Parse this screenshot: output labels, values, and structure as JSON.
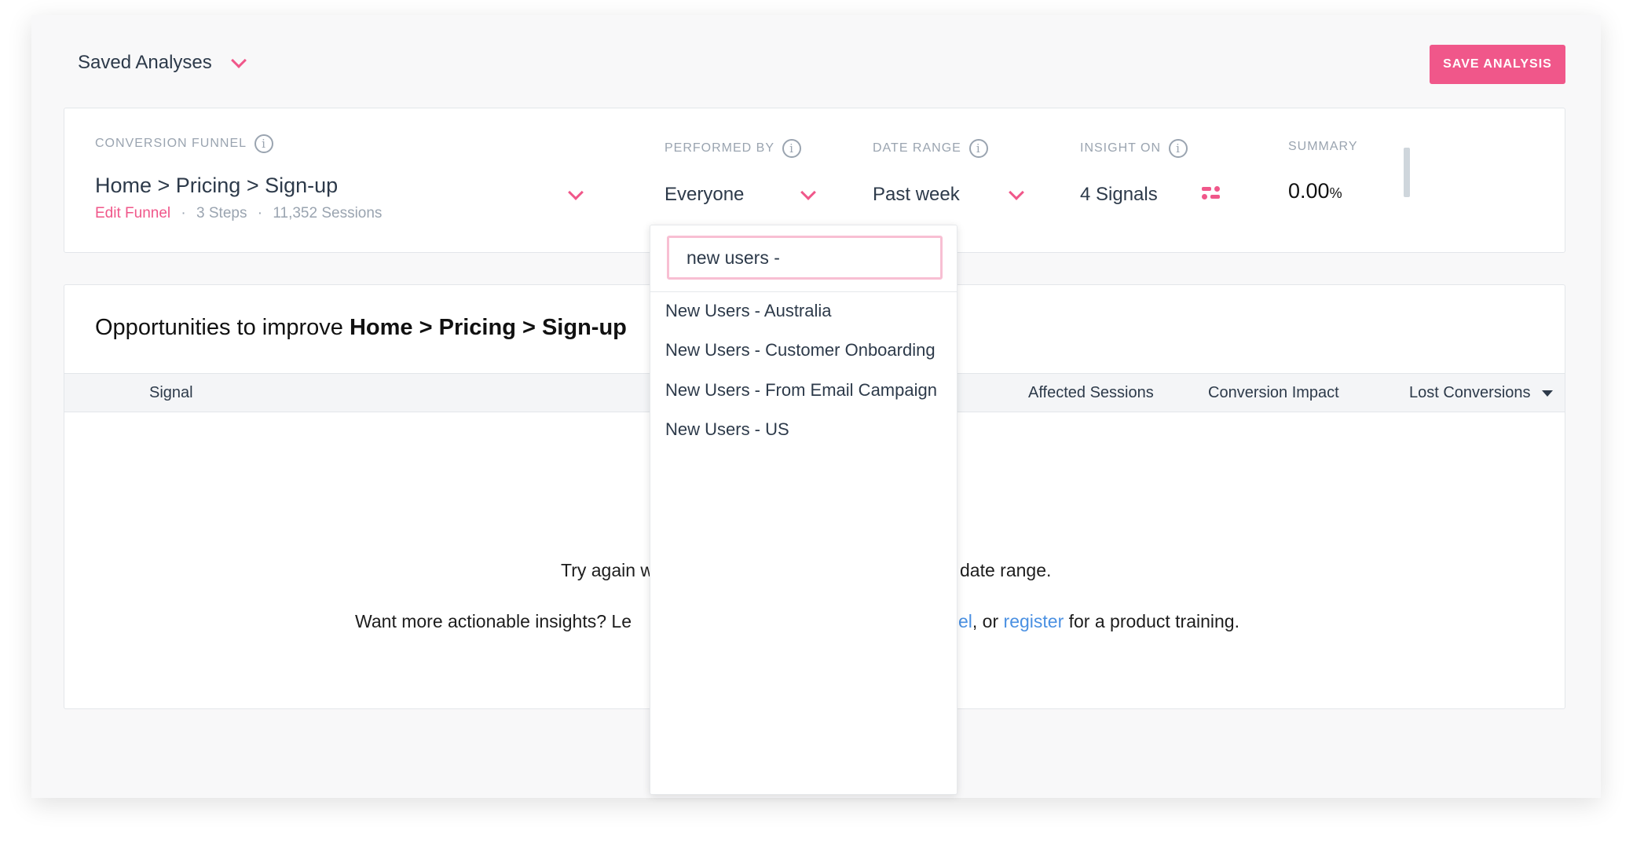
{
  "header": {
    "saved_analyses": "Saved Analyses",
    "save_button": "SAVE ANALYSIS"
  },
  "funnel": {
    "label": "CONVERSION FUNNEL",
    "name": "Home > Pricing > Sign-up",
    "edit": "Edit Funnel",
    "steps": "3 Steps",
    "sessions": "11,352 Sessions",
    "sep": "·"
  },
  "performed_by": {
    "label": "PERFORMED BY",
    "value": "Everyone"
  },
  "date_range": {
    "label": "DATE RANGE",
    "value": "Past week"
  },
  "insight_on": {
    "label": "INSIGHT ON",
    "value": "4 Signals"
  },
  "summary": {
    "label": "SUMMARY",
    "value": "0.00",
    "unit": "%"
  },
  "opportunities": {
    "heading_prefix": "Opportunities to improve ",
    "heading_funnel": "Home > Pricing > Sign-up",
    "columns": [
      "Signal",
      "Affected Sessions",
      "Conversion Impact",
      "Lost Conversions"
    ],
    "empty_line1_a": "Try again w",
    "empty_line1_b": "date range.",
    "empty_line2_a": "Want more actionable insights? Le",
    "empty_line2_b": "el",
    "empty_line2_c": ", or ",
    "empty_line2_link": "register",
    "empty_line2_d": " for a product training."
  },
  "dropdown": {
    "search_value": "new users -",
    "options": [
      "New Users - Australia",
      "New Users - Customer Onboarding",
      "New Users - From Email Campaign",
      "New Users - US"
    ]
  },
  "colors": {
    "accent": "#f0578a",
    "link": "#4a90e2"
  }
}
